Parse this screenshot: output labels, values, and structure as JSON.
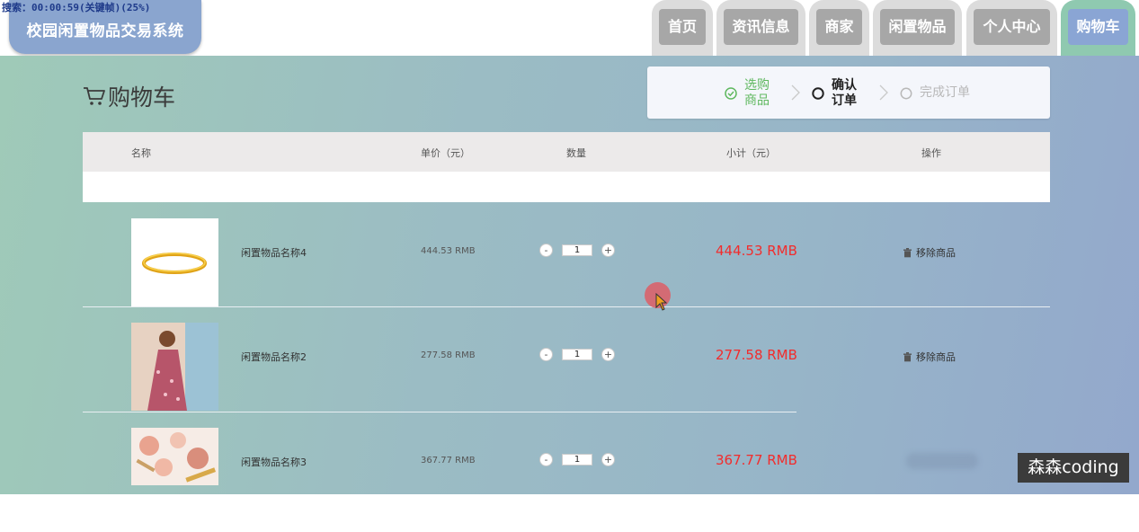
{
  "recording_overlay": "搜索：00:00:59(关键帧)(25%)",
  "app": {
    "title": "校园闲置物品交易系统"
  },
  "nav": {
    "tabs": [
      {
        "label": "首页"
      },
      {
        "label": "资讯信息"
      },
      {
        "label": "商家"
      },
      {
        "label": "闲置物品"
      },
      {
        "label": "个人中心"
      },
      {
        "label": "购物车",
        "active": true
      }
    ]
  },
  "page": {
    "title": "购物车",
    "icon": "cart-icon"
  },
  "steps": [
    {
      "label_line1": "选购",
      "label_line2": "商品",
      "state": "done",
      "color": "#5fb85f"
    },
    {
      "label_line1": "确认",
      "label_line2": "订单",
      "state": "current",
      "color": "#222222"
    },
    {
      "label": "完成订单",
      "state": "pending",
      "color": "#b8b8b8"
    }
  ],
  "table": {
    "headers": {
      "name": "名称",
      "unit_price": "单价（元）",
      "quantity": "数量",
      "subtotal": "小计（元）",
      "action": "操作"
    },
    "rows": [
      {
        "name": "闲置物品名称4",
        "price": "444.53 RMB",
        "qty": "1",
        "subtotal": "444.53 RMB",
        "action": "移除商品",
        "thumb": "gold-bracelet"
      },
      {
        "name": "闲置物品名称2",
        "price": "277.58 RMB",
        "qty": "1",
        "subtotal": "277.58 RMB",
        "action": "移除商品",
        "thumb": "floral-dress"
      },
      {
        "name": "闲置物品名称3",
        "price": "367.77 RMB",
        "qty": "1",
        "subtotal": "367.77 RMB",
        "action": "移除商品",
        "thumb": "makeup-products"
      }
    ],
    "decrement_label": "-",
    "increment_label": "+"
  },
  "watermark": "森森coding",
  "colors": {
    "accent_red": "#f22c2c",
    "logo_bg": "#8aa5cf",
    "active_tab": "#8aa5d4",
    "step_done": "#5fb85f"
  }
}
